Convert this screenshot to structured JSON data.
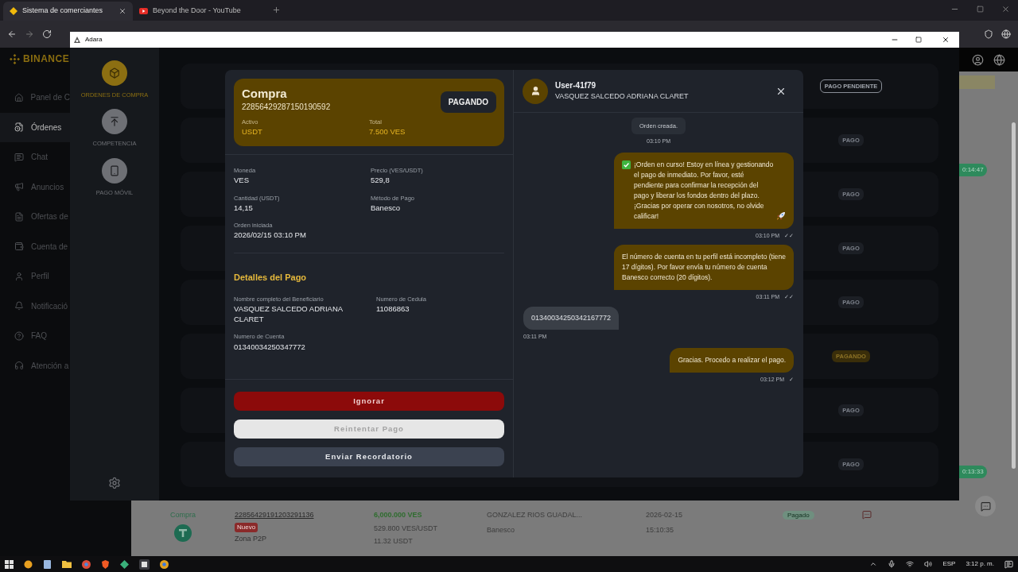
{
  "browser": {
    "tabs": [
      {
        "title": "Sistema de comerciantes",
        "selected": true
      },
      {
        "title": "Beyond the Door - YouTube",
        "selected": false
      }
    ]
  },
  "page": {
    "logo": "BINANCE",
    "nav": [
      {
        "label": "Panel de C",
        "selected": false
      },
      {
        "label": "Órdenes",
        "selected": true
      },
      {
        "label": "Chat",
        "selected": false
      },
      {
        "label": "Anuncios",
        "selected": false
      },
      {
        "label": "Ofertas de",
        "selected": false
      },
      {
        "label": "Cuenta de",
        "selected": false
      },
      {
        "label": "Perfil",
        "selected": false
      },
      {
        "label": "Notificació",
        "selected": false
      },
      {
        "label": "FAQ",
        "selected": false
      },
      {
        "label": "Atención a",
        "selected": false
      }
    ],
    "timers": [
      "0:14:47",
      "0:13:33"
    ],
    "order_row": {
      "side": "Compra",
      "order_id": "22856429191203291136",
      "tag": "Nuevo",
      "zone": "Zona P2P",
      "amount": "6,000.000 VES",
      "price": "529.800 VES/USDT",
      "quantity": "11.32 USDT",
      "counterparty": "GONZALEZ RIOS GUADAL...",
      "bank": "Banesco",
      "date": "2026-02-15",
      "time": "15:10:35",
      "status": "Pagado"
    }
  },
  "app": {
    "title": "Adara",
    "nav": [
      {
        "label": "ORDENES DE COMPRA",
        "selected": true
      },
      {
        "label": "COMPETENCIA",
        "selected": false
      },
      {
        "label": "PAGO MÓVIL",
        "selected": false
      }
    ],
    "orders": [
      {
        "status": "PAGO PENDIENTE",
        "kind": "pending"
      },
      {
        "status": "PAGO",
        "kind": "paid"
      },
      {
        "status": "PAGO",
        "kind": "paid"
      },
      {
        "status": "PAGO",
        "kind": "paid"
      },
      {
        "status": "PAGO",
        "kind": "paid"
      },
      {
        "status": "PAGANDO",
        "kind": "paying"
      },
      {
        "status": "PAGO",
        "kind": "paid"
      },
      {
        "status": "PAGO",
        "kind": "paid"
      }
    ]
  },
  "modal": {
    "title": "Compra",
    "order_id": "22856429287150190592",
    "status": "PAGANDO",
    "summary": [
      {
        "label": "Activo",
        "value": "USDT"
      },
      {
        "label": "Total",
        "value": "7.500 VES"
      }
    ],
    "details": [
      {
        "label": "Moneda",
        "value": "VES"
      },
      {
        "label": "Precio (VES/USDT)",
        "value": "529,8"
      },
      {
        "label": "Cantidad (USDT)",
        "value": "14,15"
      },
      {
        "label": "Método de Pago",
        "value": "Banesco"
      },
      {
        "label": "Orden iniciada",
        "value": "2026/02/15 03:10 PM"
      }
    ],
    "payment_title": "Detalles del Pago",
    "payment": [
      {
        "label": "Nombre completo del Beneficiario",
        "value": "VASQUEZ SALCEDO ADRIANA CLARET"
      },
      {
        "label": "Numero de Cedula",
        "value": "11086863"
      },
      {
        "label": "Numero de Cuenta",
        "value": "01340034250347772"
      }
    ],
    "buttons": [
      {
        "label": "Ignorar",
        "kind": "danger"
      },
      {
        "label": "Reintentar Pago",
        "kind": "disabled"
      },
      {
        "label": "Enviar Recordatorio",
        "kind": "secondary"
      }
    ],
    "chat": {
      "user": "User-41f79",
      "name": "VASQUEZ SALCEDO ADRIANA CLARET",
      "messages": [
        {
          "kind": "system",
          "text": "Orden creada.",
          "time": "03:10 PM"
        },
        {
          "kind": "sent",
          "text": "¡Orden en curso! Estoy en línea y gestionando el pago de inmediato. Por favor, esté pendiente para confirmar la recepción del pago y liberar los fondos dentro del plazo. ¡Gracias por operar con nosotros, no olvide calificar!",
          "time": "03:10 PM",
          "ticks": "✓✓"
        },
        {
          "kind": "sent",
          "text": "El número de cuenta en tu perfil está incompleto (tiene 17 dígitos). Por favor envía tu número de cuenta Banesco correcto (20 dígitos).",
          "time": "03:11 PM",
          "ticks": "✓✓"
        },
        {
          "kind": "received",
          "text": "01340034250342167772",
          "time": "03:11 PM"
        },
        {
          "kind": "sent",
          "text": "Gracias. Procedo a realizar el pago.",
          "time": "03:12 PM",
          "ticks": "✓"
        }
      ]
    }
  },
  "taskbar": {
    "language": "ESP",
    "time": "3:12 p. m."
  }
}
